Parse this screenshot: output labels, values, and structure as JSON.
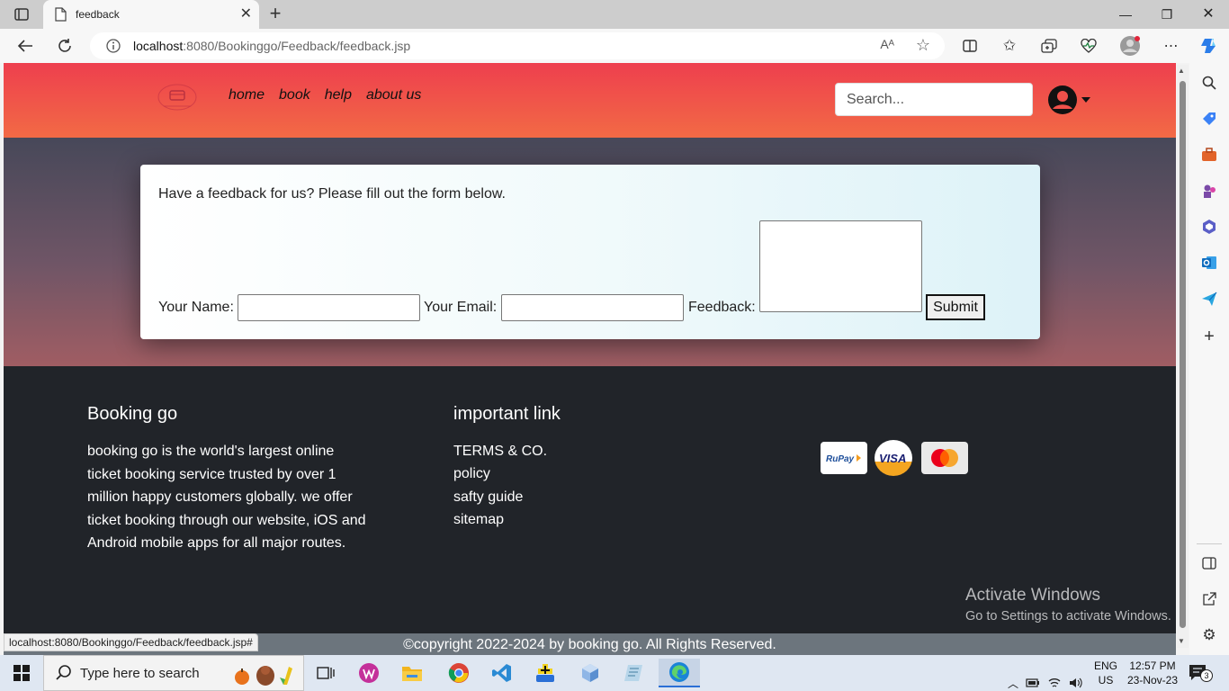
{
  "browser": {
    "tab_title": "feedback",
    "url_host": "localhost",
    "url_rest": ":8080/Bookinggo/Feedback/feedback.jsp",
    "read_aloud": "Aᴬ",
    "status_url": "localhost:8080/Bookinggo/Feedback/feedback.jsp#"
  },
  "site": {
    "nav": [
      "home",
      "book",
      "help",
      "about us"
    ],
    "search_placeholder": "Search..."
  },
  "form": {
    "intro": "Have a feedback for us? Please fill out the form below.",
    "name_label": "Your Name:",
    "email_label": "Your Email:",
    "feedback_label": "Feedback:",
    "submit_label": "Submit",
    "name_value": "",
    "email_value": "",
    "feedback_value": ""
  },
  "footer": {
    "brand_title": "Booking go",
    "about": "booking go is the world's largest online ticket booking service trusted by over 1 million happy customers globally. we offer ticket booking through our website, iOS and Android mobile apps for all major routes.",
    "links_title": "important link",
    "links": [
      "TERMS & CO.",
      "policy",
      "safty guide",
      "sitemap"
    ],
    "payments": [
      "RuPay",
      "VISA",
      "mastercard"
    ],
    "copyright": "©copyright 2022-2024 by booking go. All Rights Reserved."
  },
  "watermark": {
    "line1": "Activate Windows",
    "line2": "Go to Settings to activate Windows."
  },
  "taskbar": {
    "search_text": "Type here to search",
    "lang1": "ENG",
    "lang2": "US",
    "time": "12:57 PM",
    "date": "23-Nov-23",
    "notif_count": "3"
  },
  "colors": {
    "header_top": "#ee3f4e",
    "header_bottom": "#f26a45",
    "footer_bg": "#212429",
    "copy_bar": "#6c757d"
  }
}
